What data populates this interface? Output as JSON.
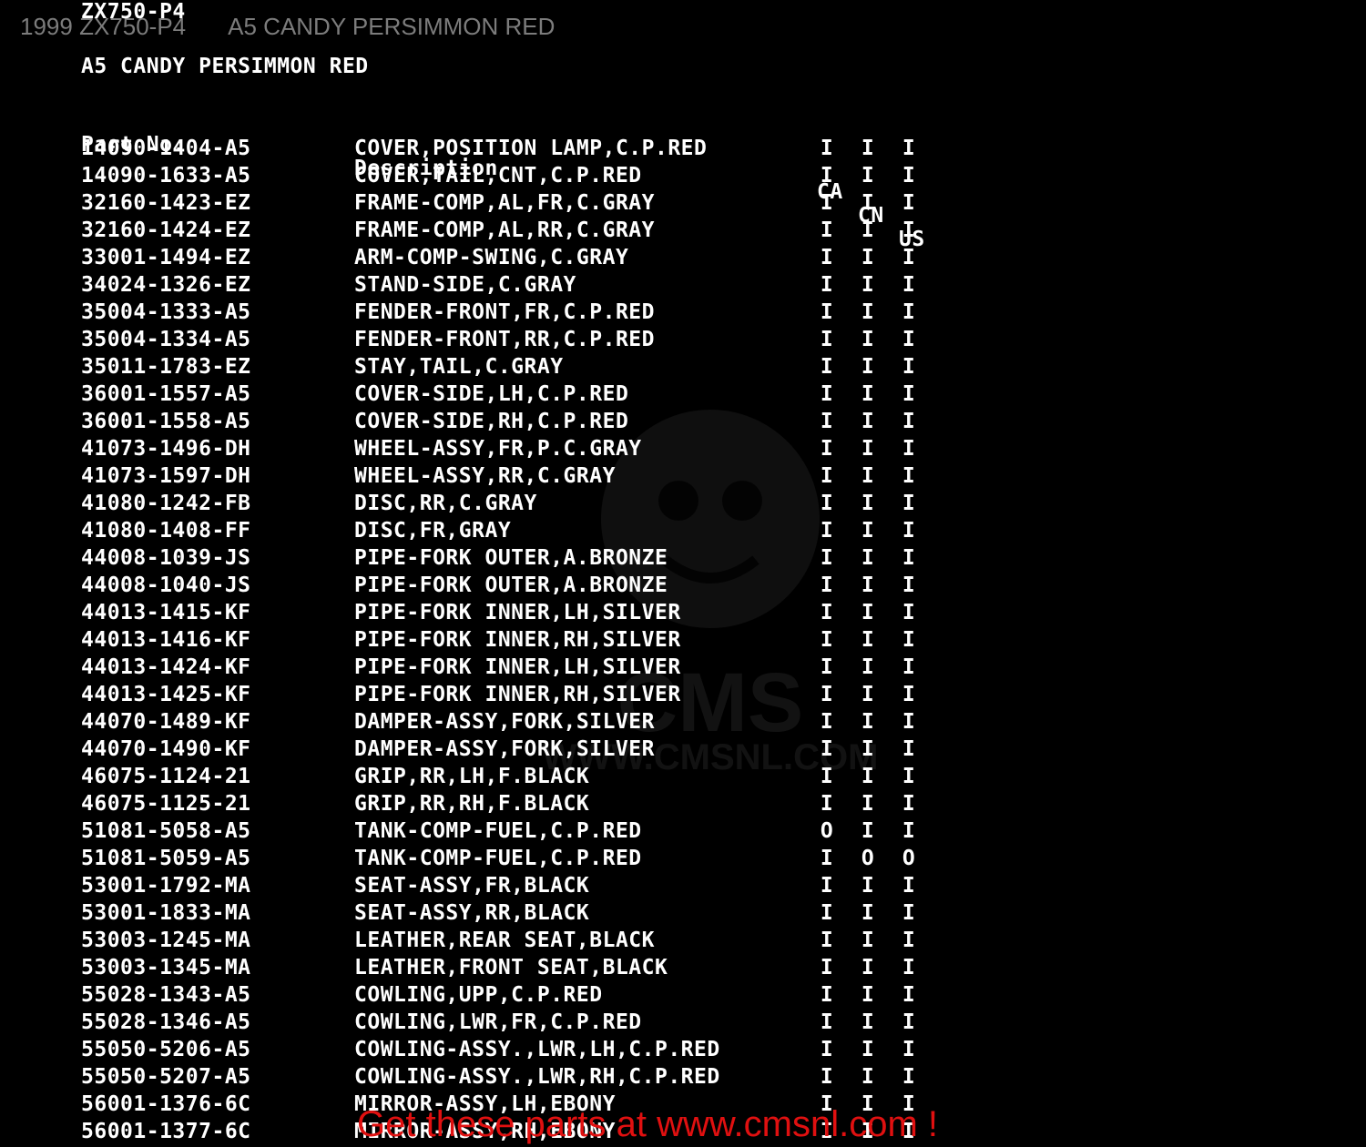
{
  "overlay": {
    "year_model": "1999 ZX750-P4",
    "color_name": "A5 CANDY PERSIMMON RED"
  },
  "document": {
    "model_code": "ZX750-P4",
    "color_heading": "A5 CANDY PERSIMMON RED",
    "headers": {
      "part_no": "Part No.",
      "description": "Description",
      "ca": "CA",
      "cn": "CN",
      "us": "US"
    },
    "rows": [
      {
        "part": "14090-1404-A5",
        "desc": "COVER,POSITION LAMP,C.P.RED",
        "ca": "I",
        "cn": "I",
        "us": "I"
      },
      {
        "part": "14090-1633-A5",
        "desc": "COVER,TAIL,CNT,C.P.RED",
        "ca": "I",
        "cn": "I",
        "us": "I"
      },
      {
        "part": "32160-1423-EZ",
        "desc": "FRAME-COMP,AL,FR,C.GRAY",
        "ca": "I",
        "cn": "I",
        "us": "I"
      },
      {
        "part": "32160-1424-EZ",
        "desc": "FRAME-COMP,AL,RR,C.GRAY",
        "ca": "I",
        "cn": "I",
        "us": "I"
      },
      {
        "part": "33001-1494-EZ",
        "desc": "ARM-COMP-SWING,C.GRAY",
        "ca": "I",
        "cn": "I",
        "us": "I"
      },
      {
        "part": "34024-1326-EZ",
        "desc": "STAND-SIDE,C.GRAY",
        "ca": "I",
        "cn": "I",
        "us": "I"
      },
      {
        "part": "35004-1333-A5",
        "desc": "FENDER-FRONT,FR,C.P.RED",
        "ca": "I",
        "cn": "I",
        "us": "I"
      },
      {
        "part": "35004-1334-A5",
        "desc": "FENDER-FRONT,RR,C.P.RED",
        "ca": "I",
        "cn": "I",
        "us": "I"
      },
      {
        "part": "35011-1783-EZ",
        "desc": "STAY,TAIL,C.GRAY",
        "ca": "I",
        "cn": "I",
        "us": "I"
      },
      {
        "part": "36001-1557-A5",
        "desc": "COVER-SIDE,LH,C.P.RED",
        "ca": "I",
        "cn": "I",
        "us": "I"
      },
      {
        "part": "36001-1558-A5",
        "desc": "COVER-SIDE,RH,C.P.RED",
        "ca": "I",
        "cn": "I",
        "us": "I"
      },
      {
        "part": "41073-1496-DH",
        "desc": "WHEEL-ASSY,FR,P.C.GRAY",
        "ca": "I",
        "cn": "I",
        "us": "I"
      },
      {
        "part": "41073-1597-DH",
        "desc": "WHEEL-ASSY,RR,C.GRAY",
        "ca": "I",
        "cn": "I",
        "us": "I"
      },
      {
        "part": "41080-1242-FB",
        "desc": "DISC,RR,C.GRAY",
        "ca": "I",
        "cn": "I",
        "us": "I"
      },
      {
        "part": "41080-1408-FF",
        "desc": "DISC,FR,GRAY",
        "ca": "I",
        "cn": "I",
        "us": "I"
      },
      {
        "part": "44008-1039-JS",
        "desc": "PIPE-FORK OUTER,A.BRONZE",
        "ca": "I",
        "cn": "I",
        "us": "I"
      },
      {
        "part": "44008-1040-JS",
        "desc": "PIPE-FORK OUTER,A.BRONZE",
        "ca": "I",
        "cn": "I",
        "us": "I"
      },
      {
        "part": "44013-1415-KF",
        "desc": "PIPE-FORK INNER,LH,SILVER",
        "ca": "I",
        "cn": "I",
        "us": "I"
      },
      {
        "part": "44013-1416-KF",
        "desc": "PIPE-FORK INNER,RH,SILVER",
        "ca": "I",
        "cn": "I",
        "us": "I"
      },
      {
        "part": "44013-1424-KF",
        "desc": "PIPE-FORK INNER,LH,SILVER",
        "ca": "I",
        "cn": "I",
        "us": "I"
      },
      {
        "part": "44013-1425-KF",
        "desc": "PIPE-FORK INNER,RH,SILVER",
        "ca": "I",
        "cn": "I",
        "us": "I"
      },
      {
        "part": "44070-1489-KF",
        "desc": "DAMPER-ASSY,FORK,SILVER",
        "ca": "I",
        "cn": "I",
        "us": "I"
      },
      {
        "part": "44070-1490-KF",
        "desc": "DAMPER-ASSY,FORK,SILVER",
        "ca": "I",
        "cn": "I",
        "us": "I"
      },
      {
        "part": "46075-1124-21",
        "desc": "GRIP,RR,LH,F.BLACK",
        "ca": "I",
        "cn": "I",
        "us": "I"
      },
      {
        "part": "46075-1125-21",
        "desc": "GRIP,RR,RH,F.BLACK",
        "ca": "I",
        "cn": "I",
        "us": "I"
      },
      {
        "part": "51081-5058-A5",
        "desc": "TANK-COMP-FUEL,C.P.RED",
        "ca": "O",
        "cn": "I",
        "us": "I"
      },
      {
        "part": "51081-5059-A5",
        "desc": "TANK-COMP-FUEL,C.P.RED",
        "ca": "I",
        "cn": "O",
        "us": "O"
      },
      {
        "part": "53001-1792-MA",
        "desc": "SEAT-ASSY,FR,BLACK",
        "ca": "I",
        "cn": "I",
        "us": "I"
      },
      {
        "part": "53001-1833-MA",
        "desc": "SEAT-ASSY,RR,BLACK",
        "ca": "I",
        "cn": "I",
        "us": "I"
      },
      {
        "part": "53003-1245-MA",
        "desc": "LEATHER,REAR SEAT,BLACK",
        "ca": "I",
        "cn": "I",
        "us": "I"
      },
      {
        "part": "53003-1345-MA",
        "desc": "LEATHER,FRONT SEAT,BLACK",
        "ca": "I",
        "cn": "I",
        "us": "I"
      },
      {
        "part": "55028-1343-A5",
        "desc": "COWLING,UPP,C.P.RED",
        "ca": "I",
        "cn": "I",
        "us": "I"
      },
      {
        "part": "55028-1346-A5",
        "desc": "COWLING,LWR,FR,C.P.RED",
        "ca": "I",
        "cn": "I",
        "us": "I"
      },
      {
        "part": "55050-5206-A5",
        "desc": "COWLING-ASSY.,LWR,LH,C.P.RED",
        "ca": "I",
        "cn": "I",
        "us": "I"
      },
      {
        "part": "55050-5207-A5",
        "desc": "COWLING-ASSY.,LWR,RH,C.P.RED",
        "ca": "I",
        "cn": "I",
        "us": "I"
      },
      {
        "part": "56001-1376-6C",
        "desc": "MIRROR-ASSY,LH,EBONY",
        "ca": "I",
        "cn": "I",
        "us": "I"
      },
      {
        "part": "56001-1377-6C",
        "desc": "MIRROR-ASSY,RH,EBONY",
        "ca": "I",
        "cn": "I",
        "us": "I"
      }
    ]
  },
  "watermark": {
    "brand": "CMS",
    "url": "WWW.CMSNL.COM"
  },
  "promo": {
    "text": "Get these parts at www.cmsnl.com !"
  },
  "colors": {
    "background": "#000000",
    "text": "#ffffff",
    "overlay_text": "#7c7c7c",
    "promo": "#e01010"
  }
}
